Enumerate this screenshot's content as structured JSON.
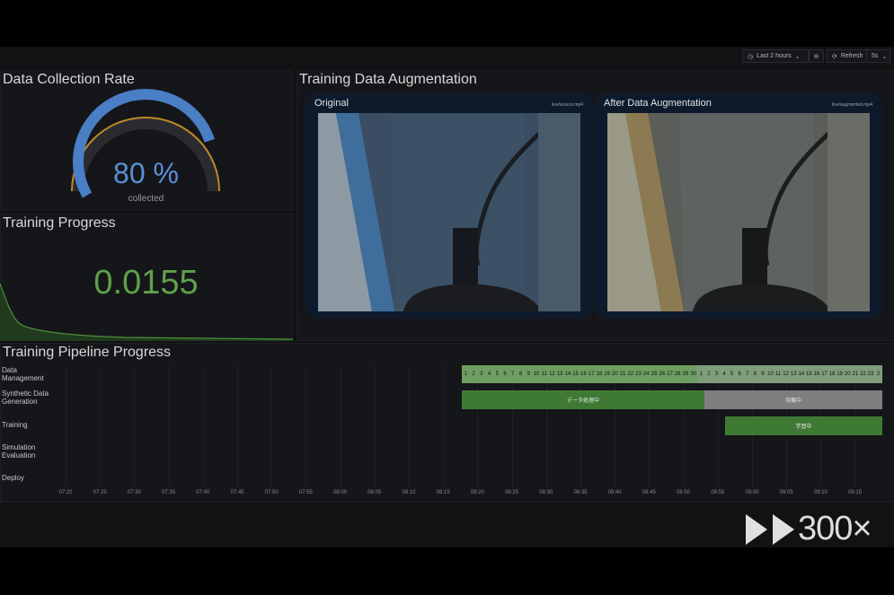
{
  "toolbar": {
    "time_range": "Last 2 hours",
    "refresh_label": "Refresh",
    "refresh_interval": "5s"
  },
  "collection": {
    "title": "Data Collection Rate",
    "value": "80 %",
    "subtitle": "collected",
    "percent": 80
  },
  "training_progress": {
    "title": "Training Progress",
    "value": "0.0155"
  },
  "augmentation": {
    "title": "Training Data Augmentation",
    "original": {
      "title": "Original",
      "source": "live/source.mp4"
    },
    "augmented": {
      "title": "After Data Augmentation",
      "source": "live/augmented.mp4"
    }
  },
  "pipeline": {
    "title": "Training Pipeline Progress",
    "rows": [
      {
        "label": "Data Management"
      },
      {
        "label": "Synthetic Data Generation"
      },
      {
        "label": "Training"
      },
      {
        "label": "Simulation Evaluation"
      },
      {
        "label": "Deploy"
      }
    ],
    "x_ticks": [
      "07:20",
      "07:25",
      "07:30",
      "07:35",
      "07:40",
      "07:45",
      "07:50",
      "07:55",
      "08:00",
      "08:05",
      "08:10",
      "08:15",
      "08:20",
      "08:25",
      "08:30",
      "08:35",
      "08:40",
      "08:45",
      "08:50",
      "08:55",
      "09:00",
      "09:05",
      "09:10",
      "09:15"
    ],
    "days_block_1": [
      "1",
      "2",
      "3",
      "4",
      "5",
      "6",
      "7",
      "8",
      "9",
      "10",
      "11",
      "12",
      "13",
      "14",
      "15",
      "16",
      "17",
      "18",
      "19",
      "20",
      "21",
      "22",
      "23",
      "24",
      "25",
      "26",
      "27",
      "28",
      "29",
      "30"
    ],
    "days_block_2": [
      "1",
      "2",
      "3",
      "4",
      "5",
      "6",
      "7",
      "8",
      "9",
      "10",
      "11",
      "12",
      "13",
      "14",
      "15",
      "16",
      "17",
      "18",
      "19",
      "20",
      "21",
      "22",
      "23",
      "2"
    ],
    "synthetic_active_label": "データ処理中",
    "synthetic_waiting_label": "待機中",
    "training_label": "学習中",
    "colors": {
      "active": "#3f7a35",
      "waiting": "#7e7e80",
      "days": "#6e9e62"
    }
  },
  "overlay": {
    "speed": "300×"
  }
}
